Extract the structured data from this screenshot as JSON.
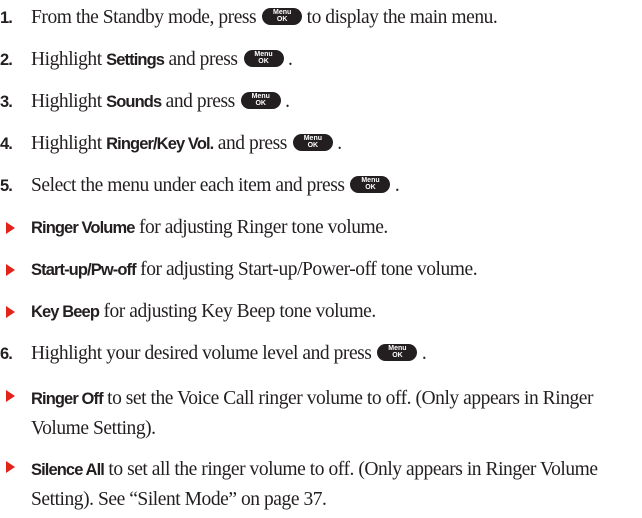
{
  "menu_key": {
    "top": "Menu",
    "bottom": "OK"
  },
  "steps": [
    {
      "num": "1.",
      "pre": "From the Standby mode, press",
      "post": " to display the main menu."
    },
    {
      "num": "2.",
      "pre": "Highlight ",
      "bold": "Settings",
      "mid": " and press",
      "post": " ."
    },
    {
      "num": "3.",
      "pre": "Highlight ",
      "bold": "Sounds",
      "mid": " and press",
      "post": " ."
    },
    {
      "num": "4.",
      "pre": "Highlight ",
      "bold": "Ringer/Key Vol.",
      "mid": " and press",
      "post": " ."
    },
    {
      "num": "5.",
      "pre": "Select the menu under each item and press",
      "post": " ."
    },
    {
      "num": "6.",
      "pre": "Highlight your desired volume level and press",
      "post": " ."
    }
  ],
  "bullets": [
    {
      "bold": "Ringer Volume",
      "text": " for adjusting Ringer tone volume."
    },
    {
      "bold": "Start-up/Pw-off",
      "text": " for adjusting Start-up/Power-off tone volume."
    },
    {
      "bold": "Key Beep",
      "text": " for adjusting Key Beep tone volume."
    },
    {
      "bold": "Ringer Off",
      "text": " to set the Voice Call ringer volume to off. (Only appears in Ringer Volume Setting)."
    },
    {
      "bold": "Silence All",
      "text": " to set all the ringer volume to off. (Only appears in Ringer Volume Setting). See “Silent Mode” on page 37."
    }
  ]
}
